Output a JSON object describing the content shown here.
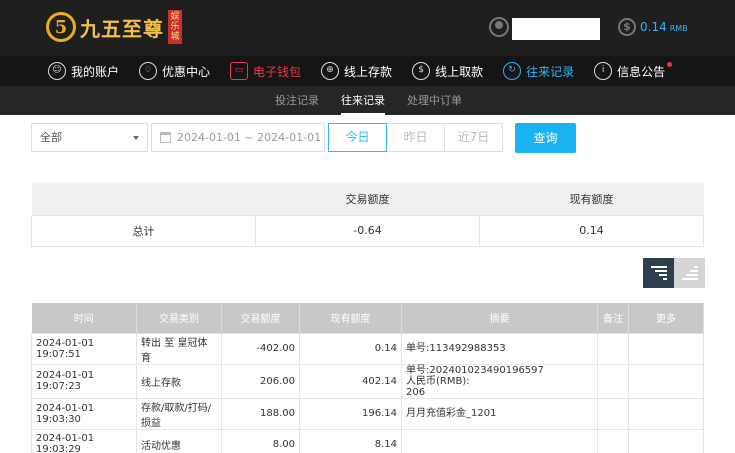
{
  "brand": {
    "mark": "5",
    "name": "九五至尊",
    "tag": "娱乐城"
  },
  "account": {
    "balance": "0.14",
    "currency": "RMB"
  },
  "nav": [
    {
      "label": "我的账户",
      "icon": "user-icon",
      "glyph": "☺",
      "style": ""
    },
    {
      "label": "优惠中心",
      "icon": "gift-icon",
      "glyph": "♢",
      "style": ""
    },
    {
      "label": "电子钱包",
      "icon": "wallet-icon",
      "glyph": "▭",
      "style": "red"
    },
    {
      "label": "线上存款",
      "icon": "deposit-icon",
      "glyph": "⊕",
      "style": ""
    },
    {
      "label": "线上取款",
      "icon": "withdraw-icon",
      "glyph": "$",
      "style": ""
    },
    {
      "label": "往来记录",
      "icon": "records-icon",
      "glyph": "↻",
      "style": "blue"
    },
    {
      "label": "信息公告",
      "icon": "notice-icon",
      "glyph": "i",
      "style": "",
      "dot": true
    }
  ],
  "subnav": [
    {
      "label": "投注记录",
      "active": false
    },
    {
      "label": "往来记录",
      "active": true
    },
    {
      "label": "处理中订单",
      "active": false
    }
  ],
  "filters": {
    "type_value": "全部",
    "date_range": "2024-01-01 ~ 2024-01-01",
    "range_buttons": [
      {
        "label": "今日",
        "active": true
      },
      {
        "label": "昨日",
        "active": false
      },
      {
        "label": "近7日",
        "active": false
      }
    ],
    "query_label": "查询"
  },
  "summary": {
    "headers": [
      "",
      "交易额度",
      "现有额度"
    ],
    "row": [
      "总计",
      "-0.64",
      "0.14"
    ]
  },
  "records": {
    "headers": [
      "时间",
      "交易类别",
      "交易额度",
      "现有额度",
      "摘要",
      "备注",
      "更多"
    ],
    "rows": [
      [
        "2024-01-01 19:07:51",
        "转出 至 皇冠体育",
        "-402.00",
        "0.14",
        "单号:113492988353",
        "",
        ""
      ],
      [
        "2024-01-01 19:07:23",
        "线上存款",
        "206.00",
        "402.14",
        "单号:202401023490196597\n人民币(RMB):\n206",
        "",
        ""
      ],
      [
        "2024-01-01 19:03:30",
        "存款/取款/打码/损益",
        "188.00",
        "196.14",
        "月月充值彩金_1201",
        "",
        ""
      ],
      [
        "2024-01-01 19:03:29",
        "活动优惠",
        "8.00",
        "8.14",
        "",
        "",
        ""
      ]
    ]
  }
}
